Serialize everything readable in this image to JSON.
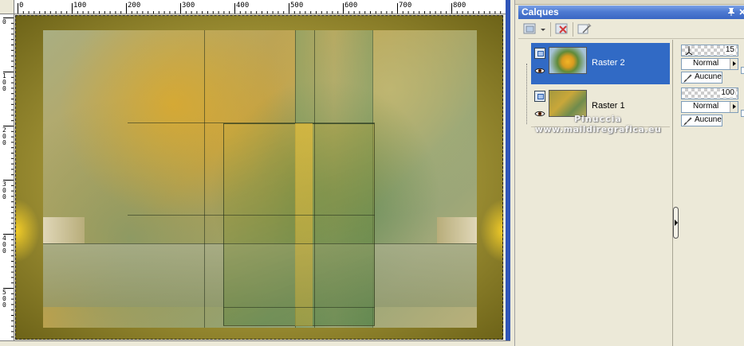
{
  "rulers": {
    "horizontal_labels": [
      "0",
      "100",
      "200",
      "300",
      "400",
      "500",
      "600",
      "700",
      "800"
    ],
    "vertical_labels": [
      "0",
      "100",
      "200",
      "300",
      "400",
      "500"
    ]
  },
  "palette": {
    "title": "Calques",
    "pin_glyph": "ᵖ",
    "close_glyph": "×",
    "toolbar": {
      "new_layer": "new-raster-layer-icon",
      "delete_layer": "delete-layer-icon",
      "layer_properties": "layer-properties-icon"
    },
    "layers": [
      {
        "name": "Raster 2",
        "selected": true,
        "visible": true,
        "opacity": "15",
        "blend_mode": "Normal",
        "mask": "Aucune"
      },
      {
        "name": "Raster 1",
        "selected": false,
        "visible": true,
        "opacity": "100",
        "blend_mode": "Normal",
        "mask": "Aucune"
      }
    ],
    "watermark": {
      "line1": "Pinuccia",
      "line2": "www.maildiregrafica.eu"
    }
  },
  "colors": {
    "selection_blue": "#316ac5",
    "titlebar_blue": "#3a67c3",
    "panel_bg": "#ece9d8"
  }
}
